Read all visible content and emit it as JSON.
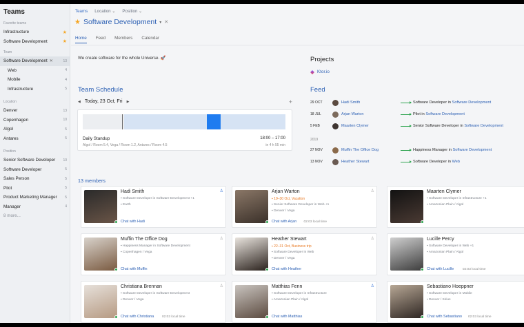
{
  "sidebar": {
    "title": "Teams",
    "favorites_label": "Favorite teams",
    "favorites": [
      {
        "label": "Infrastructure"
      },
      {
        "label": "Software Development"
      }
    ],
    "team_label": "Team",
    "team": {
      "label": "Software Development",
      "count": "13"
    },
    "team_children": [
      {
        "label": "Web",
        "count": "4"
      },
      {
        "label": "Mobile",
        "count": "4"
      },
      {
        "label": "Infrastructure",
        "count": "5"
      }
    ],
    "location_label": "Location",
    "locations": [
      {
        "label": "Denver",
        "count": "13"
      },
      {
        "label": "Copenhagen",
        "count": "10"
      },
      {
        "label": "Algol",
        "count": "5"
      },
      {
        "label": "Antares",
        "count": "5"
      }
    ],
    "position_label": "Position",
    "positions": [
      {
        "label": "Senior Software Developer",
        "count": "10"
      },
      {
        "label": "Software Developer",
        "count": "5"
      },
      {
        "label": "Sales Person",
        "count": "5"
      },
      {
        "label": "Pilot",
        "count": "5"
      },
      {
        "label": "Product Marketing Manager",
        "count": "5"
      },
      {
        "label": "Manager",
        "count": "4"
      }
    ],
    "more": "8 more..."
  },
  "breadcrumb": [
    "Teams",
    "Location",
    "Position"
  ],
  "page_title": "Software Development",
  "tabs": [
    "Home",
    "Feed",
    "Members",
    "Calendar"
  ],
  "description": "We create software for the whole Universe. 🚀",
  "schedule": {
    "title": "Team Schedule",
    "date": "Today, 23 Oct, Fri",
    "event_name": "Daily Standup",
    "event_time": "18:00 – 17:00",
    "event_location": "Algol / Room 5.4, Vega / Room 1.2, Antares / Room 4.5",
    "event_relative": "in 4 h 55 min"
  },
  "projects": {
    "title": "Projects",
    "items": [
      "Ktor.io"
    ]
  },
  "feed": {
    "title": "Feed",
    "year_label": "2019",
    "rows": [
      {
        "date": "29 OCT",
        "name": "Hadi Smith",
        "text": "Software Developer in",
        "link": "Software Development"
      },
      {
        "date": "18 JUL",
        "name": "Arjan Warton",
        "text": "Pilot in",
        "link": "Software Development"
      },
      {
        "date": "5 FEB",
        "name": "Maarten Clymer",
        "text": "Senior Software Developer in",
        "link": "Software Development"
      },
      {
        "date": "27 NOV",
        "name": "Muffin The Office Dog",
        "text": "Happiness Manager in",
        "link": "Software Development"
      },
      {
        "date": "13 NOV",
        "name": "Heather Stewart",
        "text": "Software Developer in",
        "link": "Web"
      }
    ]
  },
  "members_count": "13 members",
  "members": [
    {
      "name": "Hadi Smith",
      "status": "",
      "role": "Software Developer in Software Development  +1",
      "location": "Earth",
      "chat": "Chat with Hadi",
      "time": ""
    },
    {
      "name": "Arjan Warton",
      "status": "19–30 Oct, Vacation",
      "role": "Senior Software Developer in Web  +1",
      "location": "Denver / Vega",
      "chat": "Chat with Arjan",
      "time": "02:03 local time"
    },
    {
      "name": "Maarten Clymer",
      "status": "",
      "role": "Software Developer in Infrastructure  +1",
      "location": "Amazonian Plain / Algol",
      "chat": "",
      "time": ""
    },
    {
      "name": "Muffin The Office Dog",
      "status": "",
      "role": "Happiness Manager in Software Development",
      "location": "Copenhagen / Vega",
      "chat": "Chat with Muffin",
      "time": ""
    },
    {
      "name": "Heather Stewart",
      "status": "22–31 Oct, Business trip",
      "role": "Software Developer in Web",
      "location": "Denver / Vega",
      "chat": "Chat with Heather",
      "time": ""
    },
    {
      "name": "Lucille Percy",
      "status": "",
      "role": "Software Developer in Web  +1",
      "location": "Amazonian Plain / Algol",
      "chat": "Chat with Lucille",
      "time": "02:03 local time"
    },
    {
      "name": "Christiana Brennan",
      "status": "",
      "role": "Software Developer in Software Development",
      "location": "Denver / Vega",
      "chat": "Chat with Christiana",
      "time": "02:03 local time"
    },
    {
      "name": "Matthias Fenn",
      "status": "",
      "role": "Software Developer in Infrastructure",
      "location": "Amazonian Plain / Algol",
      "chat": "Chat with Matthias",
      "time": ""
    },
    {
      "name": "Sebastiano Hoeppner",
      "status": "",
      "role": "Software Developer in Mobile",
      "location": "Denver / Sirius",
      "chat": "Chat with Sebastiano",
      "time": "02:03 local time"
    }
  ],
  "colors": {
    "accent": "#2b5fb3",
    "online": "#2ea44f",
    "vacation": "#e8761e",
    "event": "#1f7cf0"
  }
}
